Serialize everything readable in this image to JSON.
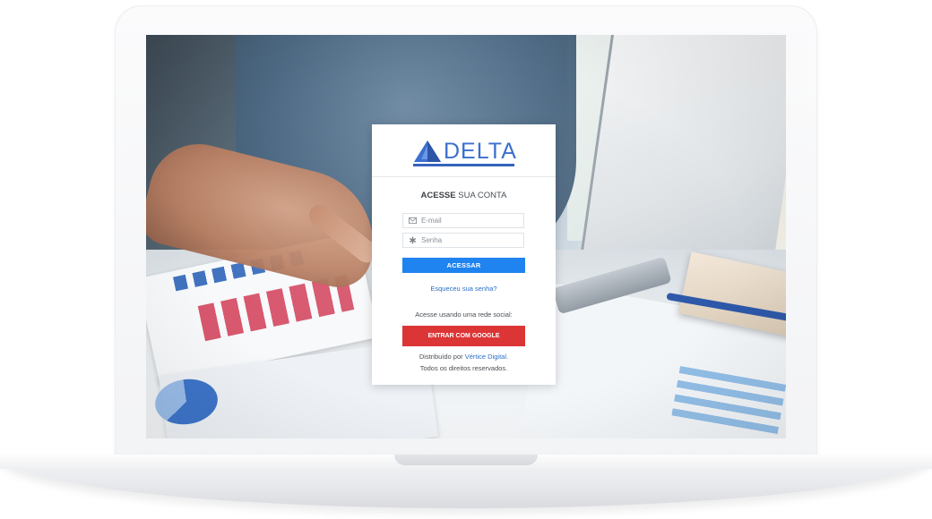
{
  "brand": {
    "name": "DELTA",
    "logo_icon": "triangle-logo-icon",
    "color": "#3b6fd0"
  },
  "login": {
    "title_strong": "ACESSE",
    "title_rest": " SUA CONTA",
    "email": {
      "placeholder": "E-mail",
      "value": "",
      "icon": "envelope-icon"
    },
    "password": {
      "placeholder": "Senha",
      "value": "",
      "icon": "asterisk-icon"
    },
    "submit_label": "ACESSAR",
    "forgot_label": "Esqueceu sua senha?",
    "social_label": "Acesse usando uma rede social:",
    "google_label": "ENTRAR COM GOOGLE"
  },
  "footer": {
    "distributed_prefix": "Distribuído por ",
    "distributor_link": "Vértice Digital",
    "distributed_suffix": ".",
    "rights": "Todos os direitos reservados."
  },
  "colors": {
    "primary_button": "#1f83f0",
    "google_button": "#dc3535",
    "link": "#2a6fc6"
  }
}
